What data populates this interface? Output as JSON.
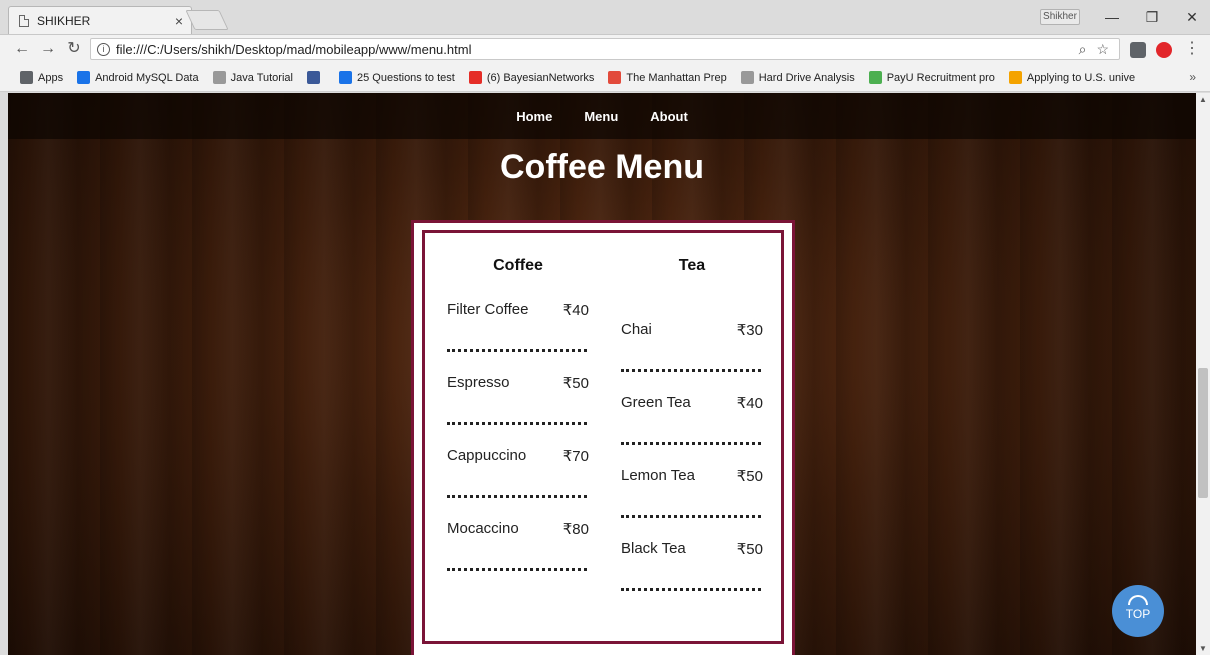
{
  "browser": {
    "tab_title": "SHIKHER",
    "tab_close": "×",
    "user_name": "Shikher",
    "url": "file:///C:/Users/shikh/Desktop/mad/mobileapp/www/menu.html",
    "bookmarks": [
      {
        "label": "Apps",
        "color": "#5f6368"
      },
      {
        "label": "Android MySQL Data",
        "color": "#1a73e8"
      },
      {
        "label": "Java Tutorial",
        "color": "#999999"
      },
      {
        "label": "",
        "color": "#3b5998"
      },
      {
        "label": "25 Questions to test",
        "color": "#1a73e8"
      },
      {
        "label": "(6) BayesianNetworks",
        "color": "#e52d27"
      },
      {
        "label": "The Manhattan Prep",
        "color": "#e24a3b"
      },
      {
        "label": "Hard Drive Analysis",
        "color": "#999999"
      },
      {
        "label": "PayU Recruitment pro",
        "color": "#4caf50"
      },
      {
        "label": "Applying to U.S. unive",
        "color": "#f4a300"
      }
    ],
    "more": "»"
  },
  "nav": {
    "items": [
      "Home",
      "Menu",
      "About"
    ]
  },
  "page": {
    "heading": "Coffee Menu"
  },
  "menu": {
    "coffee": {
      "title": "Coffee",
      "items": [
        {
          "name": "Filter Coffee",
          "price": "₹40"
        },
        {
          "name": "Espresso",
          "price": "₹50"
        },
        {
          "name": "Cappuccino",
          "price": "₹70"
        },
        {
          "name": "Mocaccino",
          "price": "₹80"
        }
      ]
    },
    "tea": {
      "title": "Tea",
      "items": [
        {
          "name": "Chai",
          "price": "₹30"
        },
        {
          "name": "Green Tea",
          "price": "₹40"
        },
        {
          "name": "Lemon Tea",
          "price": "₹50"
        },
        {
          "name": "Black Tea",
          "price": "₹50"
        }
      ]
    }
  },
  "top_button": {
    "label": "TOP"
  }
}
